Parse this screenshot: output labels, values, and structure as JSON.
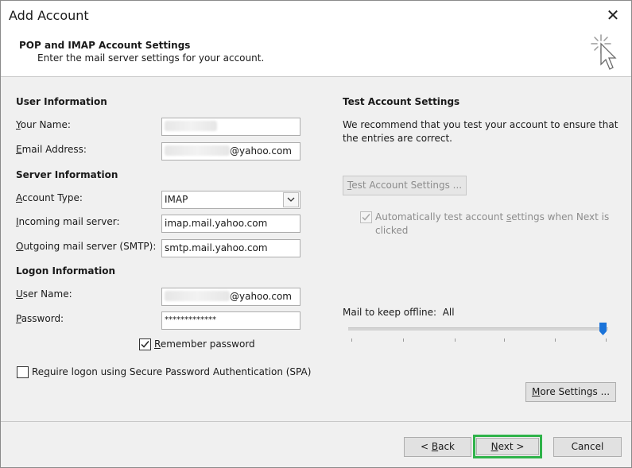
{
  "window": {
    "title": "Add Account",
    "heading": "POP and IMAP Account Settings",
    "subheading": "Enter the mail server settings for your account."
  },
  "user_info": {
    "section": "User Information",
    "name_label_pre": "",
    "name_label_u": "Y",
    "name_label_post": "our Name:",
    "email_label_pre": "",
    "email_label_u": "E",
    "email_label_post": "mail Address:",
    "email_suffix": "@yahoo.com"
  },
  "server_info": {
    "section": "Server Information",
    "account_type_label_pre": "",
    "account_type_label_u": "A",
    "account_type_label_post": "ccount Type:",
    "account_type_value": "IMAP",
    "incoming_label_pre": "",
    "incoming_label_u": "I",
    "incoming_label_post": "ncoming mail server:",
    "incoming_value": "imap.mail.yahoo.com",
    "outgoing_label_pre": "",
    "outgoing_label_u": "O",
    "outgoing_label_post": "utgoing mail server (SMTP):",
    "outgoing_value": "smtp.mail.yahoo.com"
  },
  "logon_info": {
    "section": "Logon Information",
    "username_label_pre": "",
    "username_label_u": "U",
    "username_label_post": "ser Name:",
    "username_suffix": "@yahoo.com",
    "password_label_pre": "",
    "password_label_u": "P",
    "password_label_post": "assword:",
    "password_value": "*************",
    "remember_pre": "",
    "remember_u": "R",
    "remember_post": "emember password",
    "remember_checked": true,
    "spa_pre": "Re",
    "spa_u": "q",
    "spa_post": "uire logon using Secure Password Authentication (SPA)",
    "spa_checked": false
  },
  "test_settings": {
    "section": "Test Account Settings",
    "description_line1": "We recommend that you test your account to ensure that",
    "description_line2": "the entries are correct.",
    "button_pre": "",
    "button_u": "T",
    "button_post": "est Account Settings ...",
    "auto_test_pre": "Automatically test account ",
    "auto_test_u": "s",
    "auto_test_post": "ettings when Next is",
    "auto_test_line2": "clicked",
    "auto_test_checked": true
  },
  "offline": {
    "label": "Mail to keep offline:",
    "value": "All",
    "level": 1.0
  },
  "buttons": {
    "more_settings_pre": "",
    "more_settings_u": "M",
    "more_settings_post": "ore Settings ...",
    "back_pre": "< ",
    "back_u": "B",
    "back_post": "ack",
    "next_pre": "",
    "next_u": "N",
    "next_post": "ext >",
    "cancel": "Cancel"
  },
  "colors": {
    "highlight": "#2fb34a",
    "slider_thumb": "#1a73d9"
  }
}
